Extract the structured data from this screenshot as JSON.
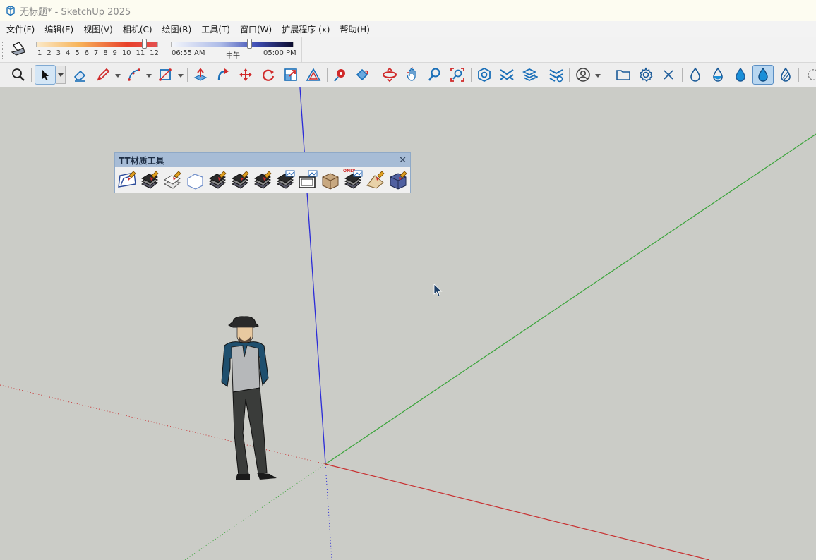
{
  "window": {
    "title": "无标题* - SketchUp 2025"
  },
  "menu": {
    "items": [
      {
        "label": "文件(F)"
      },
      {
        "label": "编辑(E)"
      },
      {
        "label": "视图(V)"
      },
      {
        "label": "相机(C)"
      },
      {
        "label": "绘图(R)"
      },
      {
        "label": "工具(T)"
      },
      {
        "label": "窗口(W)"
      },
      {
        "label": "扩展程序 (x)"
      },
      {
        "label": "帮助(H)"
      }
    ]
  },
  "shadows": {
    "months": [
      "1",
      "2",
      "3",
      "4",
      "5",
      "6",
      "7",
      "8",
      "9",
      "10",
      "11",
      "12"
    ],
    "month_value": 11,
    "time_start": "06:55 AM",
    "time_mid": "中午",
    "time_end": "05:00 PM",
    "time_fraction": 0.65
  },
  "toolbar": {
    "tools": [
      {
        "name": "search-tool",
        "icon": "magnifier-icon"
      },
      {
        "name": "select-tool",
        "icon": "arrow-cursor-icon",
        "active": true
      },
      {
        "name": "eraser-tool",
        "icon": "eraser-icon"
      },
      {
        "name": "line-tool",
        "icon": "pencil-icon"
      },
      {
        "name": "arc-tool",
        "icon": "arc-icon"
      },
      {
        "name": "rectangle-tool",
        "icon": "rectangle-icon"
      },
      {
        "name": "push-pull-tool",
        "icon": "push-pull-icon"
      },
      {
        "name": "follow-me-tool",
        "icon": "follow-me-icon"
      },
      {
        "name": "move-tool",
        "icon": "move-icon"
      },
      {
        "name": "rotate-tool",
        "icon": "rotate-icon"
      },
      {
        "name": "scale-tool",
        "icon": "scale-icon"
      },
      {
        "name": "offset-tool",
        "icon": "offset-icon"
      },
      {
        "name": "tape-measure-tool",
        "icon": "tape-icon"
      },
      {
        "name": "paint-bucket-tool",
        "icon": "paint-bucket-icon"
      },
      {
        "name": "orbit-tool",
        "icon": "orbit-icon"
      },
      {
        "name": "pan-tool",
        "icon": "hand-icon"
      },
      {
        "name": "zoom-tool",
        "icon": "zoom-icon"
      },
      {
        "name": "zoom-extents-tool",
        "icon": "zoom-extents-icon"
      },
      {
        "name": "solid-tools",
        "icon": "gear-cube-icon"
      },
      {
        "name": "sandbox-tool",
        "icon": "sandbox-icon"
      },
      {
        "name": "layers-tool",
        "icon": "layers-icon"
      },
      {
        "name": "layer-settings-tool",
        "icon": "layers-gear-icon"
      },
      {
        "name": "account-tool",
        "icon": "user-icon"
      },
      {
        "name": "open-folder-tool",
        "icon": "folder-icon"
      },
      {
        "name": "settings-tool",
        "icon": "gear-icon"
      },
      {
        "name": "close-tool",
        "icon": "close-icon"
      },
      {
        "name": "style-drop-outline",
        "icon": "drop-outline-icon"
      },
      {
        "name": "style-drop-half",
        "icon": "drop-half-icon"
      },
      {
        "name": "style-drop-filled",
        "icon": "drop-filled-icon"
      },
      {
        "name": "style-drop-active",
        "icon": "drop-filled-icon",
        "active": true
      },
      {
        "name": "style-drop-striped",
        "icon": "drop-striped-icon"
      }
    ]
  },
  "material_panel": {
    "title": "TT材质工具",
    "close": "✕",
    "icons": [
      "material-apply-icon",
      "material-stack-icon",
      "material-layers-icon",
      "material-wire-icon",
      "material-stack-icon",
      "material-stack-icon",
      "material-select-icon",
      "material-remove-icon",
      "texture-frame-icon",
      "material-box-icon",
      "material-only-icon",
      "material-paper-icon",
      "material-cube-icon"
    ],
    "only_badge": "ONLY"
  },
  "colors": {
    "blue_axis": "#2b2bd8",
    "green_axis": "#3aa43a",
    "red_axis": "#c83030",
    "viewport_bg": "#cbccc7",
    "accent": "#1a6fb8"
  }
}
